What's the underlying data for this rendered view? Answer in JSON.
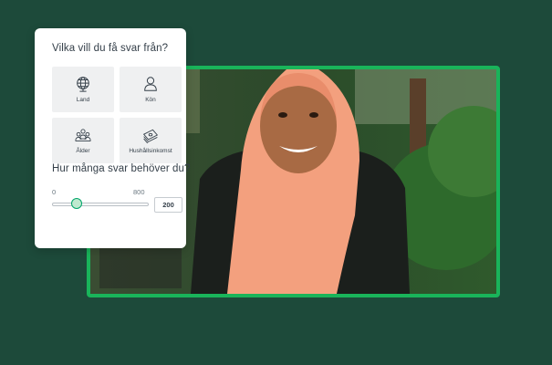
{
  "card": {
    "question_source": "Vilka vill du få svar från?",
    "tiles": [
      {
        "label": "Land",
        "icon": "globe-icon"
      },
      {
        "label": "Kön",
        "icon": "person-icon"
      },
      {
        "label": "Ålder",
        "icon": "group-icon"
      },
      {
        "label": "Hushållsinkomst",
        "icon": "money-icon"
      }
    ],
    "question_count": "Hur många svar behöver du?",
    "slider": {
      "min": "0",
      "max": "800",
      "value": "200",
      "fraction": 0.25
    }
  },
  "colors": {
    "background": "#1d4a3a",
    "frame_accent": "#19b45a",
    "slider_accent": "#00a569"
  }
}
